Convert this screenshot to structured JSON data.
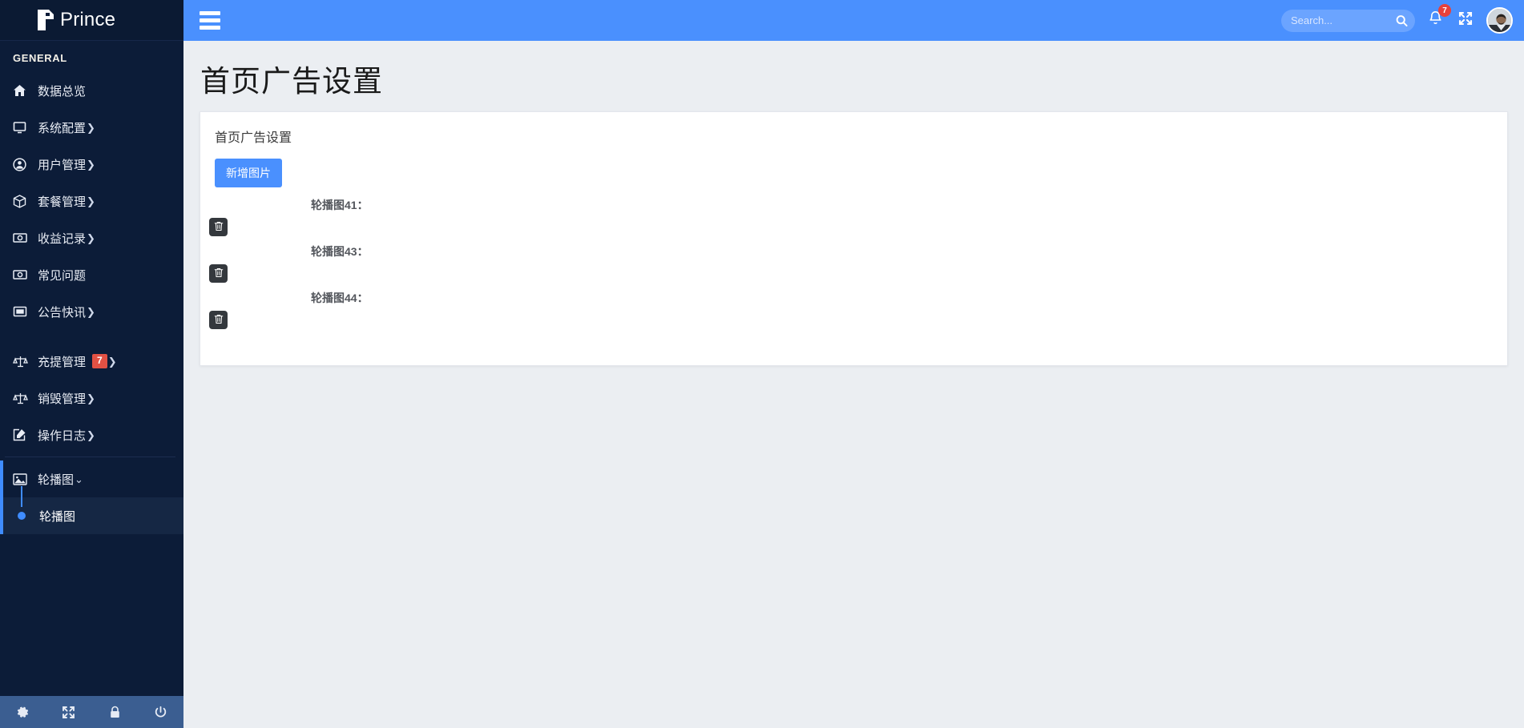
{
  "brand": {
    "name": "Prince",
    "logo_icon": "prince-p-logo-icon"
  },
  "sidebar": {
    "section_title": "GENERAL",
    "items": [
      {
        "label": "数据总览",
        "icon": "home-icon",
        "caret": "",
        "badge": ""
      },
      {
        "label": "系统配置",
        "icon": "desktop-icon",
        "caret": "❯",
        "badge": ""
      },
      {
        "label": "用户管理",
        "icon": "user-circle-icon",
        "caret": "❯",
        "badge": ""
      },
      {
        "label": "套餐管理",
        "icon": "box-icon",
        "caret": "❯",
        "badge": ""
      },
      {
        "label": "收益记录",
        "icon": "money-icon",
        "caret": "❯",
        "badge": ""
      },
      {
        "label": "常见问题",
        "icon": "money-icon",
        "caret": "",
        "badge": ""
      },
      {
        "label": "公告快讯",
        "icon": "window-icon",
        "caret": "❯",
        "badge": ""
      },
      {
        "label": "充提管理",
        "icon": "balance-scale-icon",
        "caret": "❯",
        "badge": "7"
      },
      {
        "label": "销毁管理",
        "icon": "balance-scale-icon",
        "caret": "❯",
        "badge": ""
      },
      {
        "label": "操作日志",
        "icon": "edit-square-icon",
        "caret": "❯",
        "badge": ""
      }
    ],
    "active": {
      "label": "轮播图",
      "icon": "image-icon",
      "caret": "⌄"
    },
    "submenu": [
      {
        "label": "轮播图"
      }
    ],
    "footer_icons": [
      {
        "name": "gear-icon"
      },
      {
        "name": "expand-arrows-icon"
      },
      {
        "name": "lock-icon"
      },
      {
        "name": "power-icon"
      }
    ]
  },
  "topbar": {
    "menu_toggle_icon": "hamburger-icon",
    "search": {
      "placeholder": "Search...",
      "value": "",
      "icon": "search-icon"
    },
    "notifications": {
      "icon": "bell-icon",
      "count": "7"
    },
    "fullscreen_icon": "expand-arrows-icon",
    "avatar_icon": "user-avatar"
  },
  "page": {
    "title": "首页广告设置",
    "card_header": "首页广告设置",
    "add_button": "新增图片",
    "banners": [
      {
        "label": "轮播图41：",
        "delete_icon": "trash-icon"
      },
      {
        "label": "轮播图43：",
        "delete_icon": "trash-icon"
      },
      {
        "label": "轮播图44：",
        "delete_icon": "trash-icon"
      }
    ]
  },
  "colors": {
    "sidebar_bg": "#0c1c38",
    "topbar_blue": "#4a90fe",
    "accent_blue": "#3f8cff",
    "badge_red": "#e25144",
    "page_bg": "#ebeef2",
    "footer_blue": "#3b5e91",
    "delete_dark": "#34383d"
  }
}
